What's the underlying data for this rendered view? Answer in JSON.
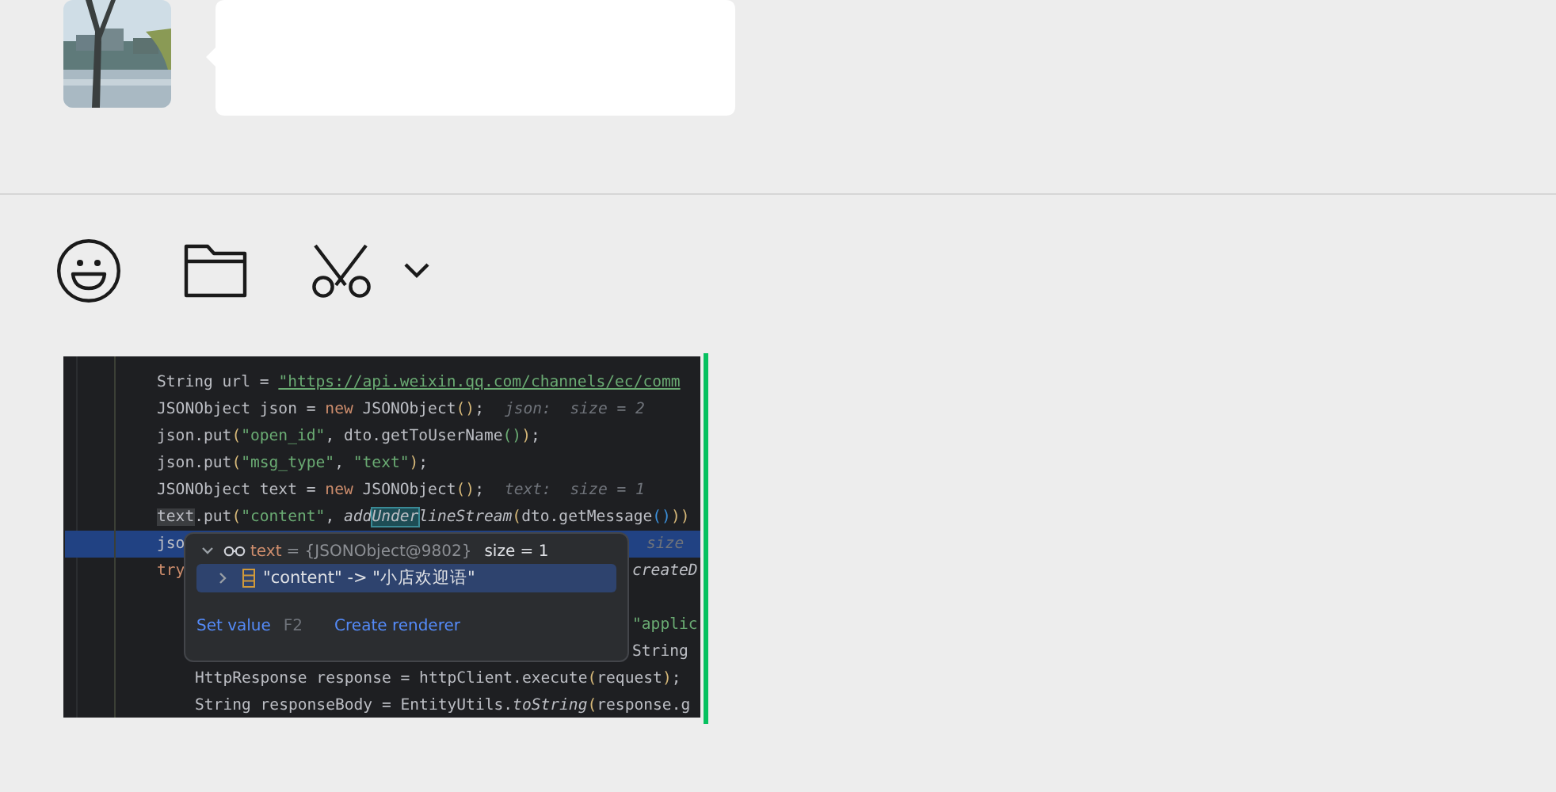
{
  "toolbar": [
    {
      "kind": "emoji"
    },
    {
      "kind": "folder"
    },
    {
      "kind": "scissors",
      "dropdown": true
    }
  ],
  "draft": {
    "kind": "code-screenshot",
    "lines": [
      {
        "current": false,
        "tokens": [
          {
            "kind": "plain",
            "t": "String url = "
          },
          {
            "kind": "link",
            "t": "\"https://api.weixin.qq.com/channels/ec/comm"
          }
        ]
      },
      {
        "current": false,
        "tokens": [
          {
            "kind": "plain",
            "t": "JSONObject json = "
          },
          {
            "kind": "kw",
            "t": "new"
          },
          {
            "kind": "plain",
            "t": " JSONObject"
          },
          {
            "kind": "paren",
            "t": "()"
          },
          {
            "kind": "plain",
            "t": ";"
          },
          {
            "kind": "hint",
            "t": "json:  size = 2"
          }
        ]
      },
      {
        "current": false,
        "tokens": [
          {
            "kind": "plain",
            "t": "json.put"
          },
          {
            "kind": "paren",
            "t": "("
          },
          {
            "kind": "str",
            "t": "\"open_id\""
          },
          {
            "kind": "plain",
            "t": ", dto.getToUserName"
          },
          {
            "kind": "paren2",
            "t": "()"
          },
          {
            "kind": "paren",
            "t": ")"
          },
          {
            "kind": "plain",
            "t": ";"
          }
        ]
      },
      {
        "current": false,
        "tokens": [
          {
            "kind": "plain",
            "t": "json.put"
          },
          {
            "kind": "paren",
            "t": "("
          },
          {
            "kind": "str",
            "t": "\"msg_type\""
          },
          {
            "kind": "plain",
            "t": ", "
          },
          {
            "kind": "str",
            "t": "\"text\""
          },
          {
            "kind": "paren",
            "t": ")"
          },
          {
            "kind": "plain",
            "t": ";"
          }
        ]
      },
      {
        "current": false,
        "tokens": [
          {
            "kind": "plain",
            "t": "JSONObject text = "
          },
          {
            "kind": "kw",
            "t": "new"
          },
          {
            "kind": "plain",
            "t": " JSONObject"
          },
          {
            "kind": "paren",
            "t": "()"
          },
          {
            "kind": "plain",
            "t": ";"
          },
          {
            "kind": "hint",
            "t": "text:  size = 1"
          }
        ]
      },
      {
        "current": false,
        "tokens": [
          {
            "kind": "ref",
            "t": "text"
          },
          {
            "kind": "plain",
            "t": ".put"
          },
          {
            "kind": "paren",
            "t": "("
          },
          {
            "kind": "str",
            "t": "\"content\""
          },
          {
            "kind": "plain",
            "t": ", "
          },
          {
            "kind": "ital",
            "t": "add"
          },
          {
            "kind": "match",
            "t": "Under"
          },
          {
            "kind": "ital",
            "t": "lineStream"
          },
          {
            "kind": "paren",
            "t": "("
          },
          {
            "kind": "plain",
            "t": "dto.getMessage"
          },
          {
            "kind": "paren3",
            "t": "()"
          },
          {
            "kind": "paren",
            "t": "))"
          }
        ]
      },
      {
        "current": true,
        "tokens": [
          {
            "kind": "plain",
            "t": "jso"
          }
        ],
        "right": [
          {
            "kind": "hint",
            "t": "size"
          }
        ]
      },
      {
        "current": false,
        "tokens": [
          {
            "kind": "kw",
            "t": "try"
          }
        ],
        "right": [
          {
            "kind": "ital",
            "t": "createD"
          }
        ],
        "children": [
          {
            "current": false,
            "gap_before": true,
            "right": [
              {
                "kind": "str",
                "t": "\"applic"
              }
            ]
          },
          {
            "current": false,
            "right": [
              {
                "kind": "plain",
                "t": "String"
              }
            ]
          },
          {
            "current": false,
            "tokens": [
              {
                "kind": "plain",
                "t": "HttpResponse response = httpClient.execute"
              },
              {
                "kind": "paren",
                "t": "("
              },
              {
                "kind": "plain",
                "t": "request"
              },
              {
                "kind": "paren",
                "t": ")"
              },
              {
                "kind": "plain",
                "t": ";"
              }
            ]
          },
          {
            "current": false,
            "tokens": [
              {
                "kind": "plain",
                "t": "String responseBody = EntityUtils."
              },
              {
                "kind": "ital",
                "t": "toString"
              },
              {
                "kind": "paren",
                "t": "("
              },
              {
                "kind": "plain",
                "t": "response.g"
              }
            ]
          }
        ]
      }
    ],
    "popup": {
      "header": {
        "expanded": true,
        "name": "text",
        "value": " = {JSONObject@9802}",
        "size": "size = 1"
      },
      "items": [
        {
          "expanded": false,
          "selected": true,
          "label": "\"content\" -> \"小店欢迎语\""
        }
      ],
      "actions": [
        {
          "label": "Set value",
          "shortcut": "F2"
        },
        {
          "label": "Create renderer"
        }
      ]
    }
  }
}
